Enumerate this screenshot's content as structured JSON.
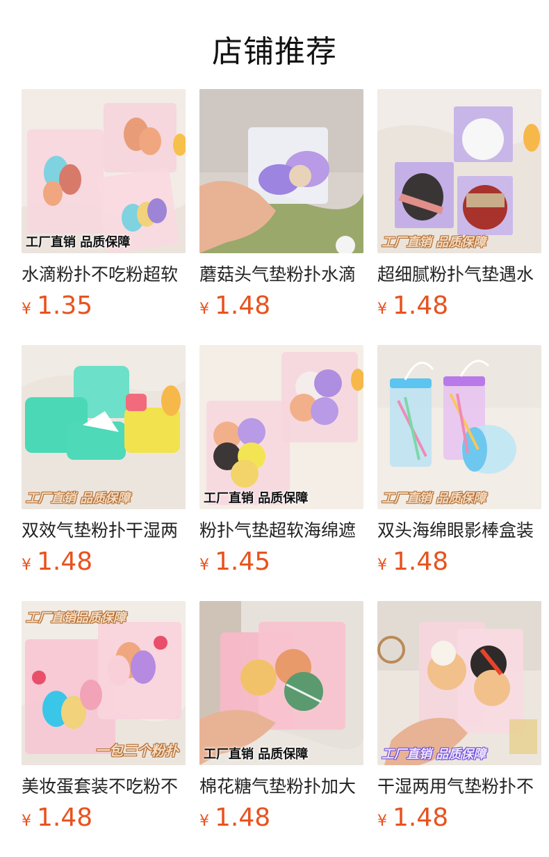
{
  "page": {
    "title": "店铺推荐"
  },
  "currency_symbol": "¥",
  "products": [
    {
      "name": "水滴粉扑不吃粉超软",
      "price": "1.35",
      "badge": "工厂直销 品质保障",
      "badge_style": "black"
    },
    {
      "name": "蘑菇头气垫粉扑水滴",
      "price": "1.48",
      "badge": "",
      "badge_style": "none"
    },
    {
      "name": "超细腻粉扑气垫遇水",
      "price": "1.48",
      "badge": "工厂直销 品质保障",
      "badge_style": "orange"
    },
    {
      "name": "双效气垫粉扑干湿两",
      "price": "1.48",
      "badge": "工厂直销 品质保障",
      "badge_style": "orange"
    },
    {
      "name": "粉扑气垫超软海绵遮",
      "price": "1.45",
      "badge": "工厂直销 品质保障",
      "badge_style": "black"
    },
    {
      "name": "双头海绵眼影棒盒装",
      "price": "1.48",
      "badge": "工厂直销 品质保障",
      "badge_style": "orange"
    },
    {
      "name": "美妆蛋套装不吃粉不",
      "price": "1.48",
      "badge": "工厂直销品质保障",
      "badge_style": "orange-top",
      "badge2": "一包三个粉扑"
    },
    {
      "name": "棉花糖气垫粉扑加大",
      "price": "1.48",
      "badge": "工厂直销 品质保障",
      "badge_style": "black"
    },
    {
      "name": "干湿两用气垫粉扑不",
      "price": "1.48",
      "badge": "工厂直销 品质保障",
      "badge_style": "purple"
    }
  ]
}
